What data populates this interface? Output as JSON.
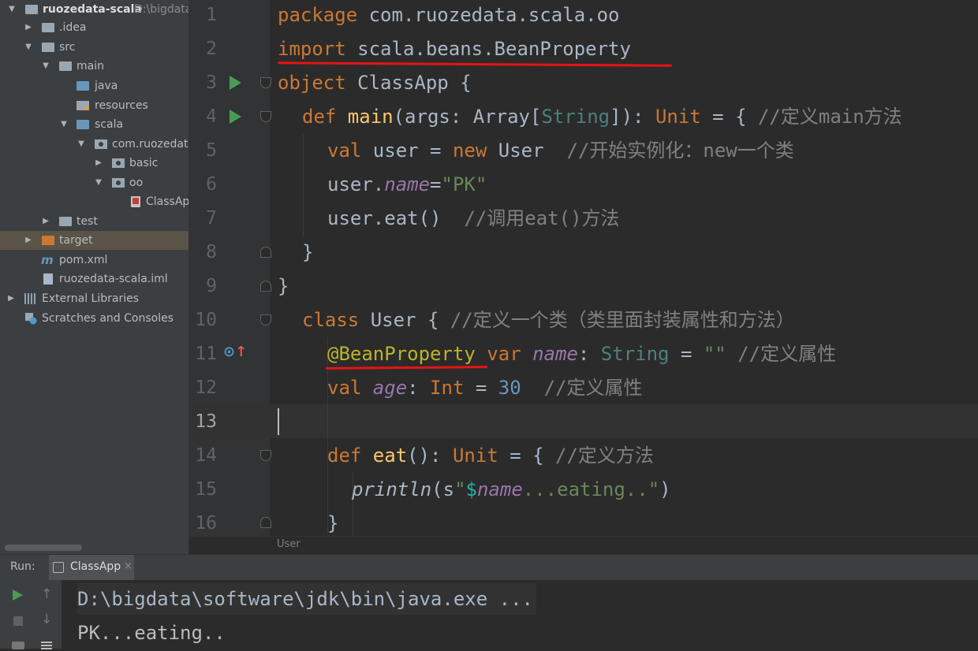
{
  "project": {
    "root_name": "ruozedata-scala",
    "root_path": "D:\\bigdata",
    "items": [
      {
        "label": ".idea"
      },
      {
        "label": "src"
      },
      {
        "label": "main"
      },
      {
        "label": "java"
      },
      {
        "label": "resources"
      },
      {
        "label": "scala"
      },
      {
        "label": "com.ruozedata"
      },
      {
        "label": "basic"
      },
      {
        "label": "oo"
      },
      {
        "label": "ClassApp"
      },
      {
        "label": "test"
      },
      {
        "label": "target"
      },
      {
        "label": "pom.xml"
      },
      {
        "label": "ruozedata-scala.iml"
      },
      {
        "label": "External Libraries"
      },
      {
        "label": "Scratches and Consoles"
      }
    ]
  },
  "editor": {
    "line_numbers": [
      "1",
      "2",
      "3",
      "4",
      "5",
      "6",
      "7",
      "8",
      "9",
      "10",
      "11",
      "12",
      "13",
      "14",
      "15",
      "16"
    ],
    "current_line": "13",
    "breadcrumb": "User",
    "code": {
      "l1_kw": "package",
      "l1_rest": " com.ruozedata.scala.oo",
      "l2_kw": "import",
      "l2_rest": " scala.beans.BeanProperty",
      "l3_kw": "object",
      "l3_rest": " ClassApp {",
      "l4_kw": "def ",
      "l4_fn": "main",
      "l4_a": "(args: Array[",
      "l4_type": "String",
      "l4_b": "]): ",
      "l4_unit": "Unit",
      "l4_c": " = { ",
      "l4_cm": "//定义main方法",
      "l5_kw": "val",
      "l5_a": " user = ",
      "l5_new": "new",
      "l5_b": " User  ",
      "l5_cm": "//开始实例化：new一个类",
      "l6_a": "user.",
      "l6_fld": "name",
      "l6_b": "=",
      "l6_str": "\"PK\"",
      "l7_a": "user.eat()  ",
      "l7_cm": "//调用eat()方法",
      "l8": "}",
      "l9": "}",
      "l10_kw": "class",
      "l10_a": " User { ",
      "l10_cm": "//定义一个类（类里面封装属性和方法）",
      "l11_ann": "@BeanProperty",
      "l11_kw": " var ",
      "l11_fld": "name",
      "l11_a": ": ",
      "l11_type": "String",
      "l11_b": " = ",
      "l11_str": "\"\"",
      "l11_cm": " //定义属性",
      "l12_kw": "val ",
      "l12_fld": "age",
      "l12_a": ": ",
      "l12_type": "Int",
      "l12_b": " = ",
      "l12_num": "30",
      "l12_cm": "  //定义属性",
      "l14_kw": "def ",
      "l14_fn": "eat",
      "l14_a": "(): ",
      "l14_unit": "Unit",
      "l14_b": " = { ",
      "l14_cm": "//定义方法",
      "l15_fn": "println",
      "l15_a": "(s",
      "l15_q1": "\"",
      "l15_var": "$",
      "l15_fld": "name",
      "l15_str": "...eating..\"",
      "l15_b": ")",
      "l16": "}"
    }
  },
  "run": {
    "label": "Run:",
    "tab": "ClassApp",
    "tab_close": "×",
    "lines": [
      "D:\\bigdata\\software\\jdk\\bin\\java.exe ...",
      "PK...eating.."
    ]
  }
}
